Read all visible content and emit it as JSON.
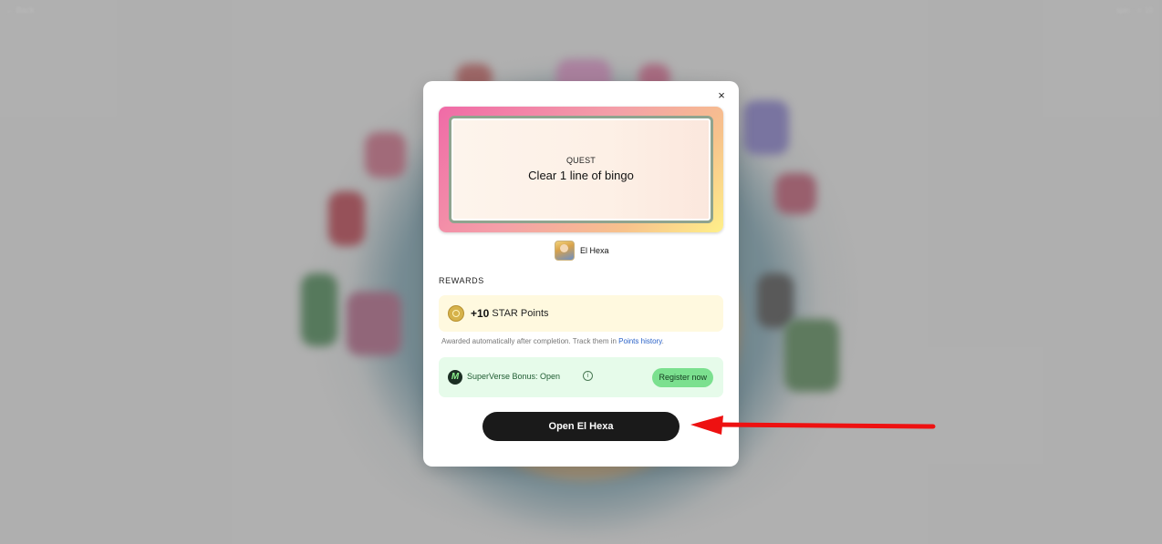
{
  "header": {
    "back_label": "← Back",
    "right_text": "spin · ☆ 10"
  },
  "modal": {
    "close_label": "×",
    "quest": {
      "label": "QUEST",
      "title": "Clear 1 line of bingo"
    },
    "game": {
      "name": "El Hexa",
      "icon": "game-avatar-icon"
    },
    "rewards": {
      "label": "REWARDS",
      "star_amount": "+10",
      "star_unit": "STAR Points",
      "awarded_text": "Awarded automatically after completion. Track them in ",
      "points_history_link": "Points history",
      "awarded_suffix": "."
    },
    "bonus": {
      "logo_letter": "M",
      "text": "SuperVerse Bonus: Open",
      "info_glyph": "i",
      "register_label": "Register now"
    },
    "open_button_label": "Open El Hexa"
  },
  "colors": {
    "open_button": "#1a1a1a",
    "register_button": "#7be08f",
    "star_box": "#fff9df",
    "bonus_box": "#e6fbea",
    "annotation_arrow": "#ee1111"
  }
}
